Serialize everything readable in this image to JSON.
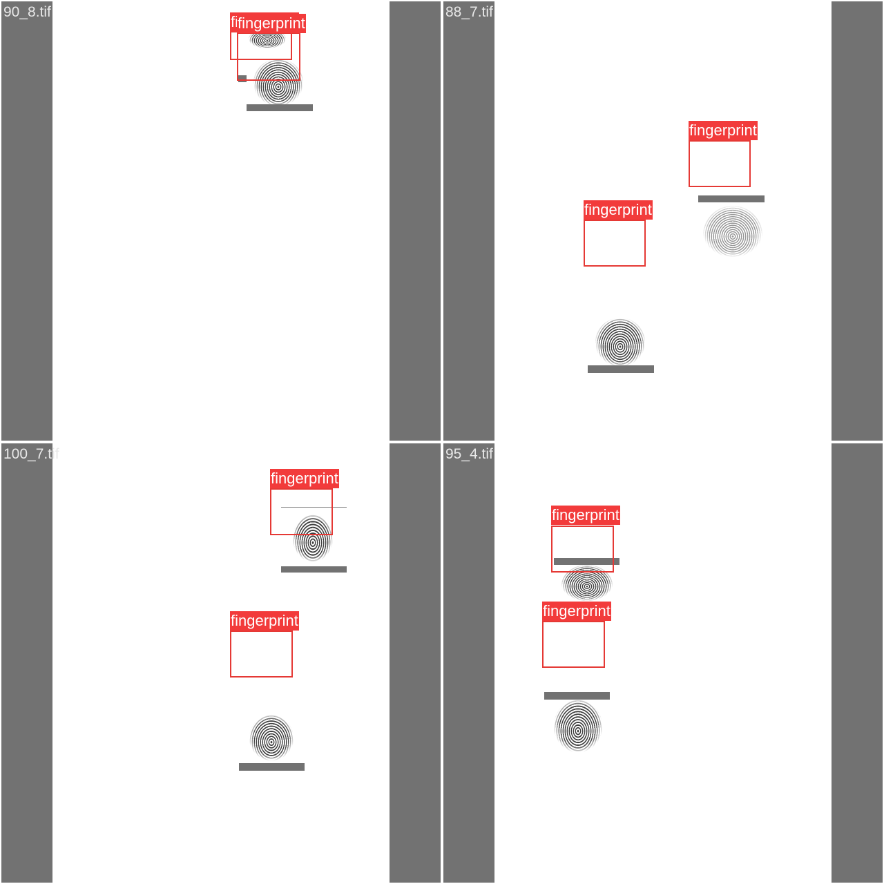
{
  "tiles": [
    {
      "filename": "90_8.tif",
      "labels": [
        "fingerprint",
        "fingerprint"
      ]
    },
    {
      "filename": "88_7.tif",
      "labels": [
        "fingerprint",
        "fingerprint"
      ]
    },
    {
      "filename": "100_7.tif",
      "labels": [
        "fingerprint",
        "fingerprint"
      ]
    },
    {
      "filename": "95_4.tif",
      "labels": [
        "fingerprint",
        "fingerprint"
      ]
    }
  ],
  "colors": {
    "box": "#e53935",
    "label_bg": "#f23b3b",
    "letterbox": "#727272"
  }
}
